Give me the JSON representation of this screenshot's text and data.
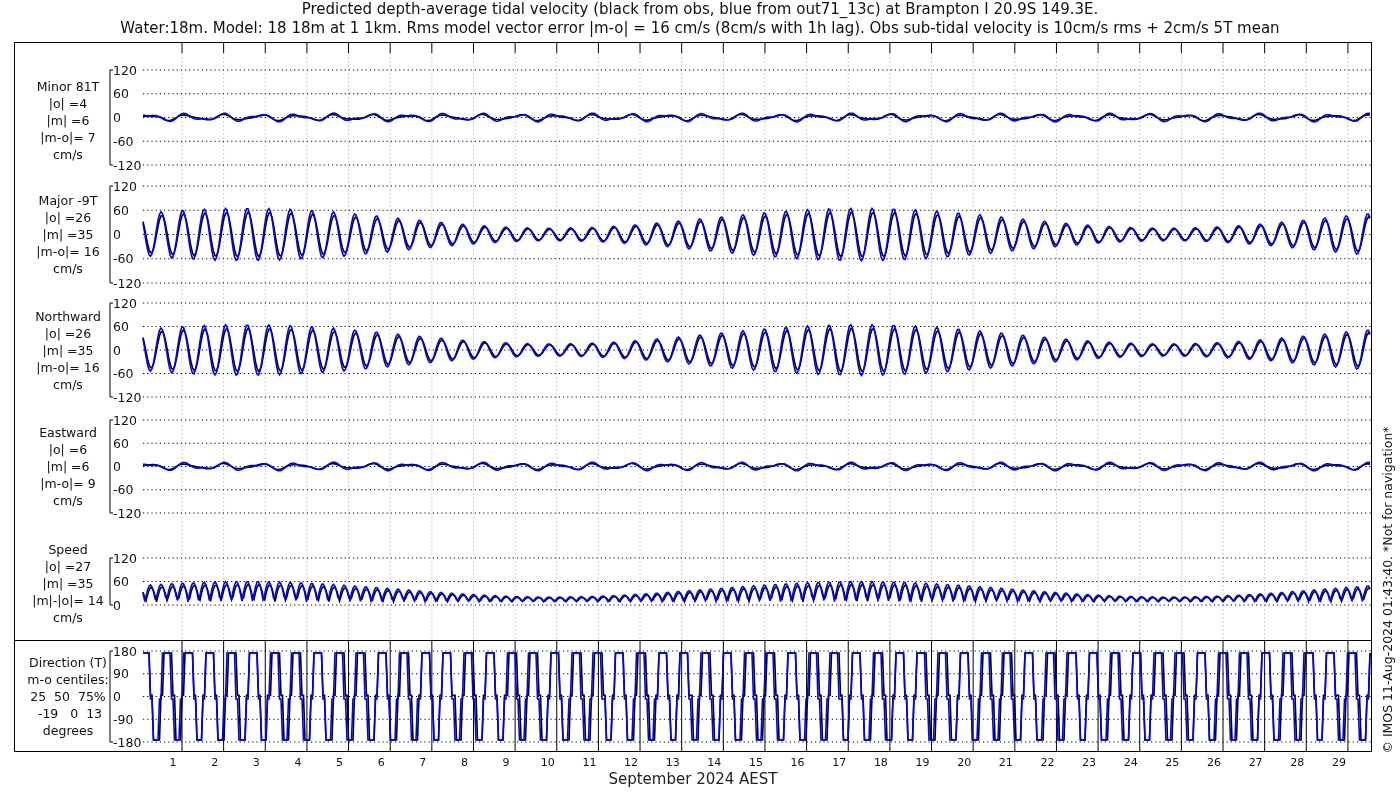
{
  "title_lines": [
    "Predicted depth-average tidal velocity (black from obs, blue from out71_13c) at Brampton I 20.9S 149.3E.",
    "Water:18m. Model: 18 18m at 1 1km. Rms model vector error |m-o| = 16 cm/s (8cm/s with 1h lag). Obs sub-tidal velocity is 10cm/s rms + 2cm/s 5T mean"
  ],
  "panels": [
    {
      "kind": "minor",
      "label_lines": [
        "Minor 81T",
        "|o| =4",
        "|m| =6",
        "|m-o|= 7",
        "cm/s"
      ],
      "yticks": [
        "120",
        "60",
        "0",
        "-60",
        "-120"
      ]
    },
    {
      "kind": "major",
      "label_lines": [
        "Major -9T",
        "|o| =26",
        "|m| =35",
        "|m-o|= 16",
        "cm/s"
      ],
      "yticks": [
        "120",
        "60",
        "0",
        "-60",
        "-120"
      ]
    },
    {
      "kind": "major",
      "label_lines": [
        "Northward",
        "|o| =26",
        "|m| =35",
        "|m-o|= 16",
        "cm/s"
      ],
      "yticks": [
        "120",
        "60",
        "0",
        "-60",
        "-120"
      ]
    },
    {
      "kind": "minor",
      "label_lines": [
        "Eastward",
        "|o| =6",
        "|m| =6",
        "|m-o|= 9",
        "cm/s"
      ],
      "yticks": [
        "120",
        "60",
        "0",
        "-60",
        "-120"
      ]
    },
    {
      "kind": "speed",
      "label_lines": [
        "Speed",
        "|o| =27",
        "|m| =35",
        "|m|-|o|= 14",
        "cm/s"
      ],
      "yticks": [
        "120",
        "60",
        "0"
      ]
    },
    {
      "kind": "direction",
      "label_lines": [
        "Direction (T)",
        "m-o centiles:",
        "25  50  75%",
        " -19   0  13",
        "degrees"
      ],
      "yticks": [
        "180",
        "90",
        "0",
        "-90",
        "-180"
      ]
    }
  ],
  "x_axis": {
    "day_labels": [
      "1",
      "2",
      "3",
      "4",
      "5",
      "6",
      "7",
      "8",
      "9",
      "10",
      "11",
      "12",
      "13",
      "14",
      "15",
      "16",
      "17",
      "18",
      "19",
      "20",
      "21",
      "22",
      "23",
      "24",
      "25",
      "26",
      "27",
      "28",
      "29"
    ],
    "xlabel": "September 2024 AEST"
  },
  "credit": "© IMOS 11-Aug-2024 01:43:40. *Not for navigation*"
}
